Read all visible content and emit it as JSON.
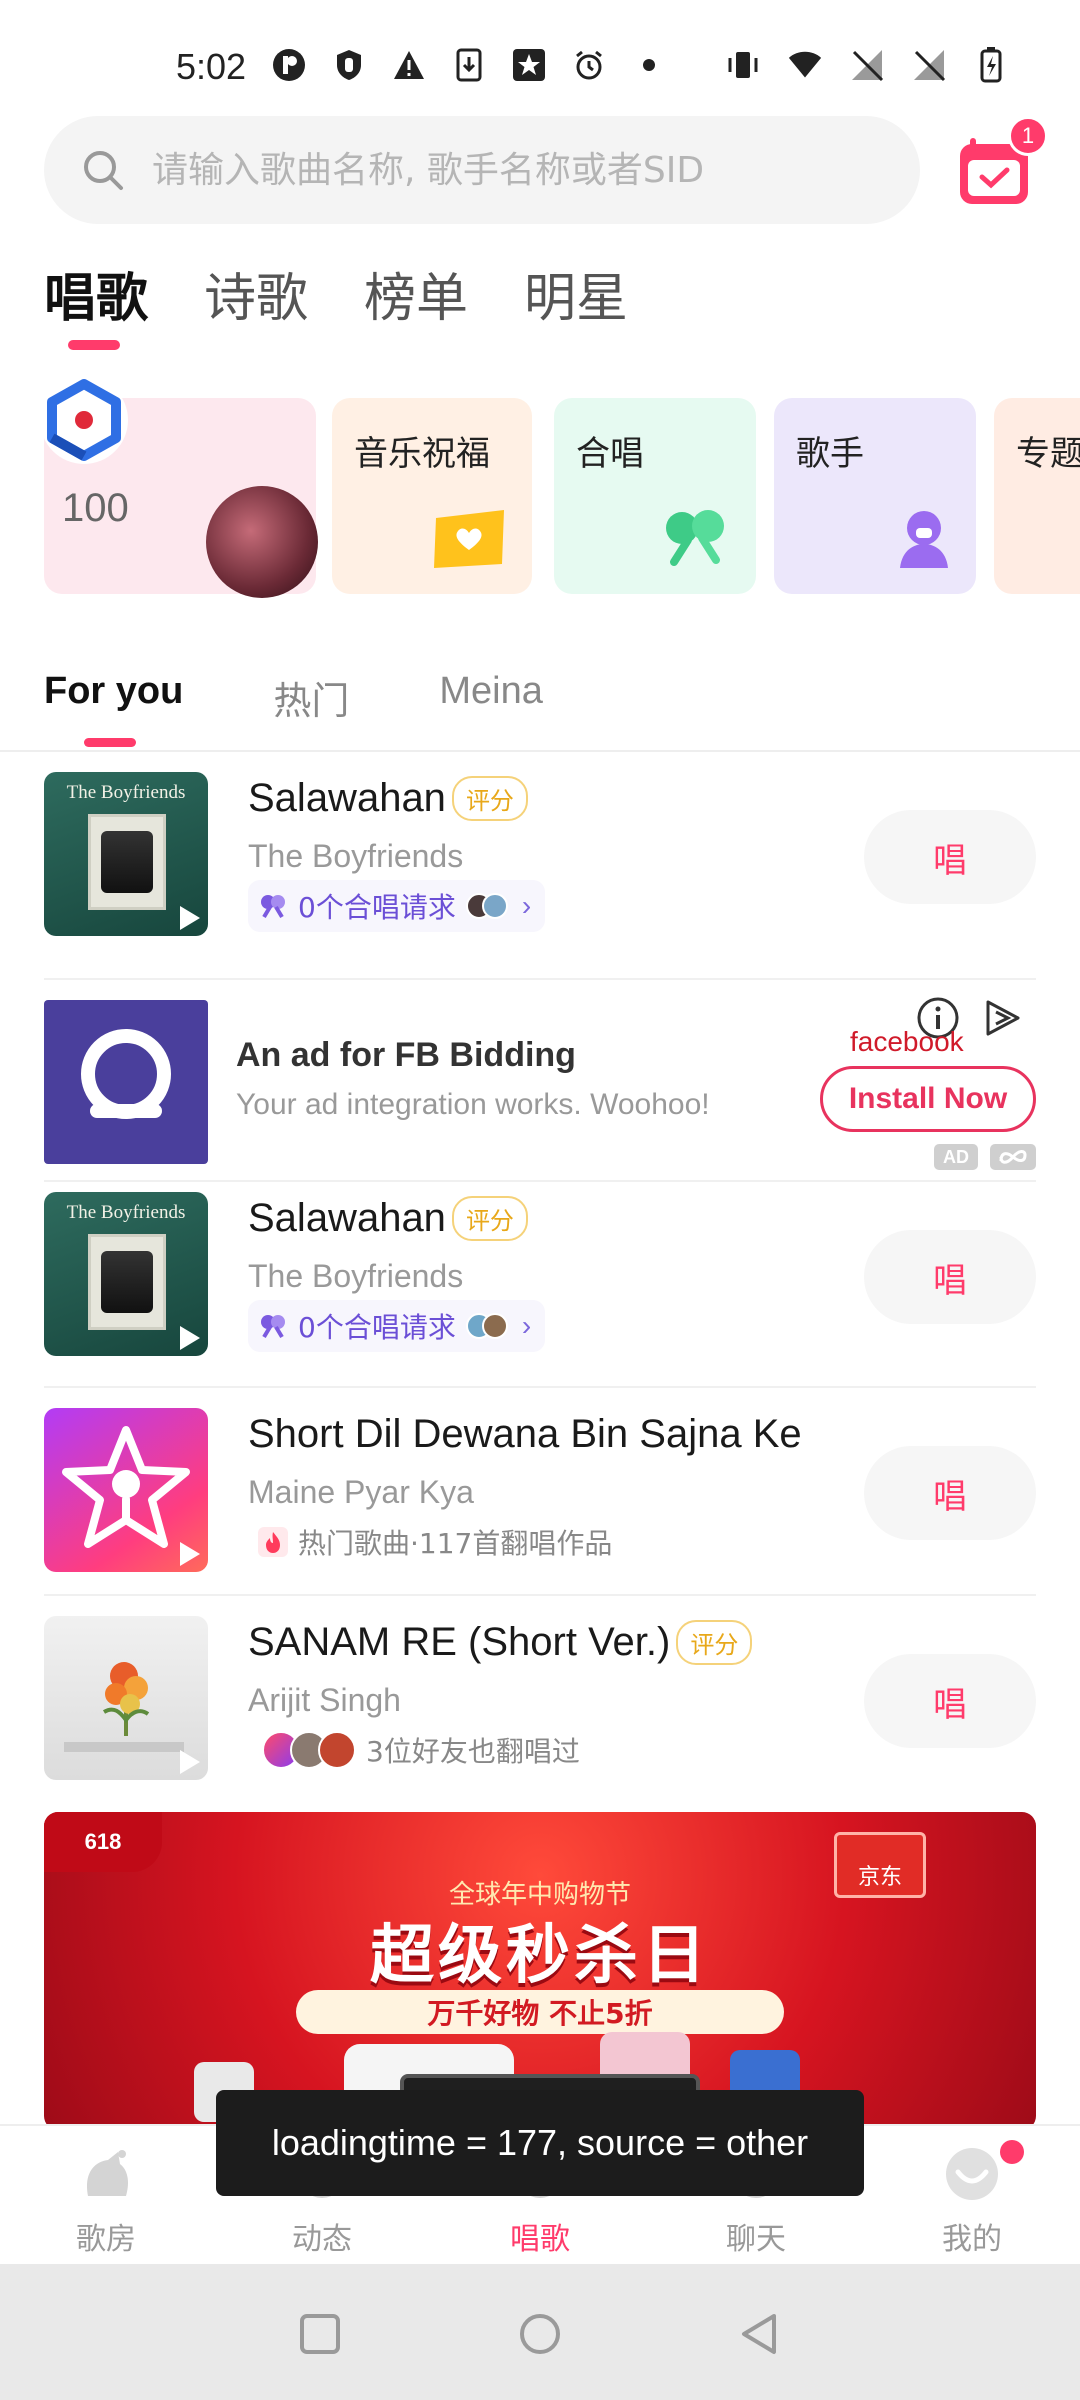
{
  "status_bar": {
    "time": "5:02"
  },
  "search": {
    "placeholder": "请输入歌曲名称, 歌手名称或者SID"
  },
  "calendar_badge": "1",
  "top_tabs": [
    {
      "label": "唱歌",
      "active": true
    },
    {
      "label": "诗歌",
      "active": false
    },
    {
      "label": "榜单",
      "active": false
    },
    {
      "label": "明星",
      "active": false
    }
  ],
  "categories": [
    {
      "label": "",
      "count": "100"
    },
    {
      "label": "音乐祝福"
    },
    {
      "label": "合唱"
    },
    {
      "label": "歌手"
    },
    {
      "label": "专题"
    }
  ],
  "sub_tabs": [
    {
      "label": "For you",
      "active": true
    },
    {
      "label": "热门",
      "active": false
    },
    {
      "label": "Meina",
      "active": false
    }
  ],
  "songs": [
    {
      "title": "Salawahan",
      "tag": "评分",
      "artist": "The Boyfriends",
      "meta": "0个合唱请求",
      "cover_title": "The Boyfriends",
      "action": "唱"
    },
    {
      "title": "Salawahan",
      "tag": "评分",
      "artist": "The Boyfriends",
      "meta": "0个合唱请求",
      "cover_title": "The Boyfriends",
      "action": "唱"
    },
    {
      "title": "Short Dil Dewana Bin Sajna Ke",
      "artist": "Maine Pyar Kya",
      "meta": "热门歌曲·117首翻唱作品",
      "action": "唱"
    },
    {
      "title": "SANAM RE (Short Ver.)",
      "tag": "评分",
      "artist": "Arijit Singh",
      "meta": "3位好友也翻唱过",
      "action": "唱"
    }
  ],
  "ad": {
    "title": "An ad for FB Bidding",
    "subtitle": "Your ad integration works. Woohoo!",
    "brand": "facebook",
    "cta": "Install Now",
    "tag": "AD"
  },
  "banner": {
    "badge": "618",
    "brand": "京东",
    "small_text": "全球年中购物节",
    "headline": "超级秒杀日",
    "pill": "万千好物 不止5折"
  },
  "toast": "loadingtime = 177, source = other",
  "bottom_nav": [
    {
      "label": "歌房",
      "active": false
    },
    {
      "label": "动态",
      "active": false
    },
    {
      "label": "唱歌",
      "active": true
    },
    {
      "label": "聊天",
      "active": false
    },
    {
      "label": "我的",
      "active": false
    }
  ],
  "colors": {
    "accent": "#ff3b6b",
    "chorus_text": "#6b4fd6",
    "rate_tag": "#e8a81a"
  }
}
